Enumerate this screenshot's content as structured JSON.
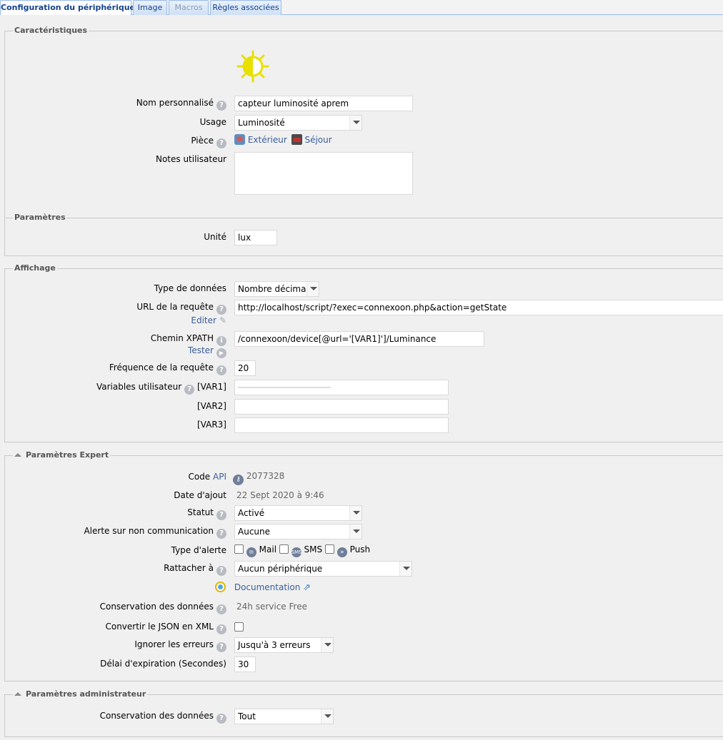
{
  "tabs": [
    {
      "label": "Configuration du périphérique"
    },
    {
      "label": "Image"
    },
    {
      "label": "Macros"
    },
    {
      "label": "Règles associées"
    }
  ],
  "characteristics": {
    "legend": "Caractéristiques",
    "name_label": "Nom personnalisé",
    "name_value": "capteur luminosité aprem",
    "usage_label": "Usage",
    "usage_value": "Luminosité",
    "room_label": "Pièce",
    "room_parent": "Extérieur",
    "room_child": "Séjour",
    "notes_label": "Notes utilisateur",
    "notes_value": ""
  },
  "parameters": {
    "legend": "Paramètres",
    "unit_label": "Unité",
    "unit_value": "lux"
  },
  "display": {
    "legend": "Affichage",
    "datatype_label": "Type de données",
    "datatype_value": "Nombre décimal",
    "url_label": "URL de la requête",
    "url_value": "http://localhost/script/?exec=connexoon.php&action=getState",
    "edit_link": "Editer",
    "xpath_label": "Chemin XPATH",
    "xpath_value": "/connexoon/device[@url='[VAR1]']/Luminance",
    "test_link": "Tester",
    "freq_label": "Fréquence de la requête",
    "freq_value": "20",
    "vars_label": "Variables utilisateur",
    "var1_label": "[VAR1]",
    "var2_label": "[VAR2]",
    "var3_label": "[VAR3]"
  },
  "expert": {
    "legend": "Paramètres Expert",
    "code_label": "Code",
    "api_link": "API",
    "code_value": "2077328",
    "date_label": "Date d'ajout",
    "date_value": "22 Sept 2020 à 9:46",
    "status_label": "Statut",
    "status_value": "Activé",
    "alert_label": "Alerte sur non communication",
    "alert_value": "Aucune",
    "alerttype_label": "Type d'alerte",
    "mail_label": "Mail",
    "sms_label": "SMS",
    "sms_icon_text": "SMS",
    "push_label": "Push",
    "attach_label": "Rattacher à",
    "attach_value": "Aucun périphérique",
    "doc_link": "Documentation",
    "conservation_label": "Conservation des données",
    "conservation_value": "24h service Free",
    "json_label": "Convertir le JSON en XML",
    "ignore_label": "Ignorer les erreurs",
    "ignore_value": "Jusqu'à 3 erreurs",
    "timeout_label": "Délai d'expiration (Secondes)",
    "timeout_value": "30"
  },
  "admin": {
    "legend": "Paramètres administrateur",
    "conservation_label": "Conservation des données",
    "conservation_value": "Tout"
  },
  "colors": {
    "accent": "#15428b",
    "link": "#3a5d9a",
    "sun_icon": "#e8e000"
  }
}
